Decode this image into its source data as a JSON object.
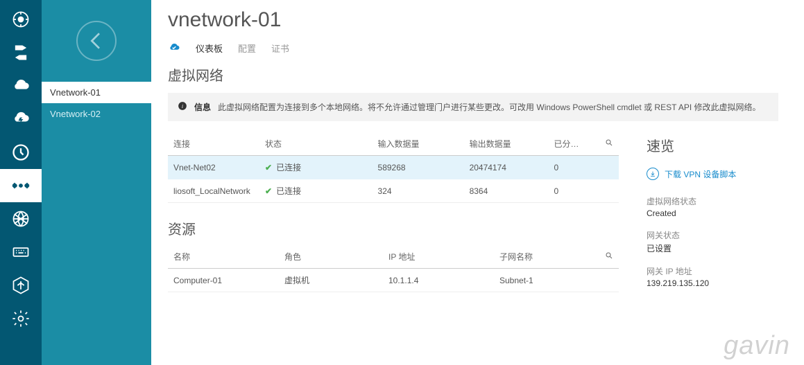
{
  "sidebar": {
    "items": [
      "Vnetwork-01",
      "Vnetwork-02"
    ],
    "selected": 0
  },
  "header": {
    "title": "vnetwork-01",
    "tabs": [
      "仪表板",
      "配置",
      "证书"
    ],
    "activeTab": 0
  },
  "section1": {
    "title": "虚拟网络",
    "info_label": "信息",
    "info_text": "此虚拟网络配置为连接到多个本地网络。将不允许通过管理门户进行某些更改。可改用 Windows PowerShell cmdlet 或 REST API 修改此虚拟网络。"
  },
  "conn_table": {
    "headers": [
      "连接",
      "状态",
      "输入数据量",
      "输出数据量",
      "已分…"
    ],
    "rows": [
      {
        "name": "Vnet-Net02",
        "status": "已连接",
        "in": "589268",
        "out": "20474174",
        "alloc": "0",
        "selected": true
      },
      {
        "name": "liosoft_LocalNetwork",
        "status": "已连接",
        "in": "324",
        "out": "8364",
        "alloc": "0",
        "selected": false
      }
    ]
  },
  "section2": {
    "title": "资源"
  },
  "res_table": {
    "headers": [
      "名称",
      "角色",
      "IP 地址",
      "子网名称"
    ],
    "rows": [
      {
        "name": "Computer-01",
        "role": "虚拟机",
        "ip": "10.1.1.4",
        "subnet": "Subnet-1"
      }
    ]
  },
  "quickview": {
    "title": "速览",
    "link": "下载 VPN 设备脚本",
    "groups": [
      {
        "label": "虚拟网络状态",
        "value": "Created"
      },
      {
        "label": "网关状态",
        "value": "已设置"
      },
      {
        "label": "网关 IP 地址",
        "value": "139.219.135.120"
      }
    ]
  },
  "watermark": "gavin"
}
